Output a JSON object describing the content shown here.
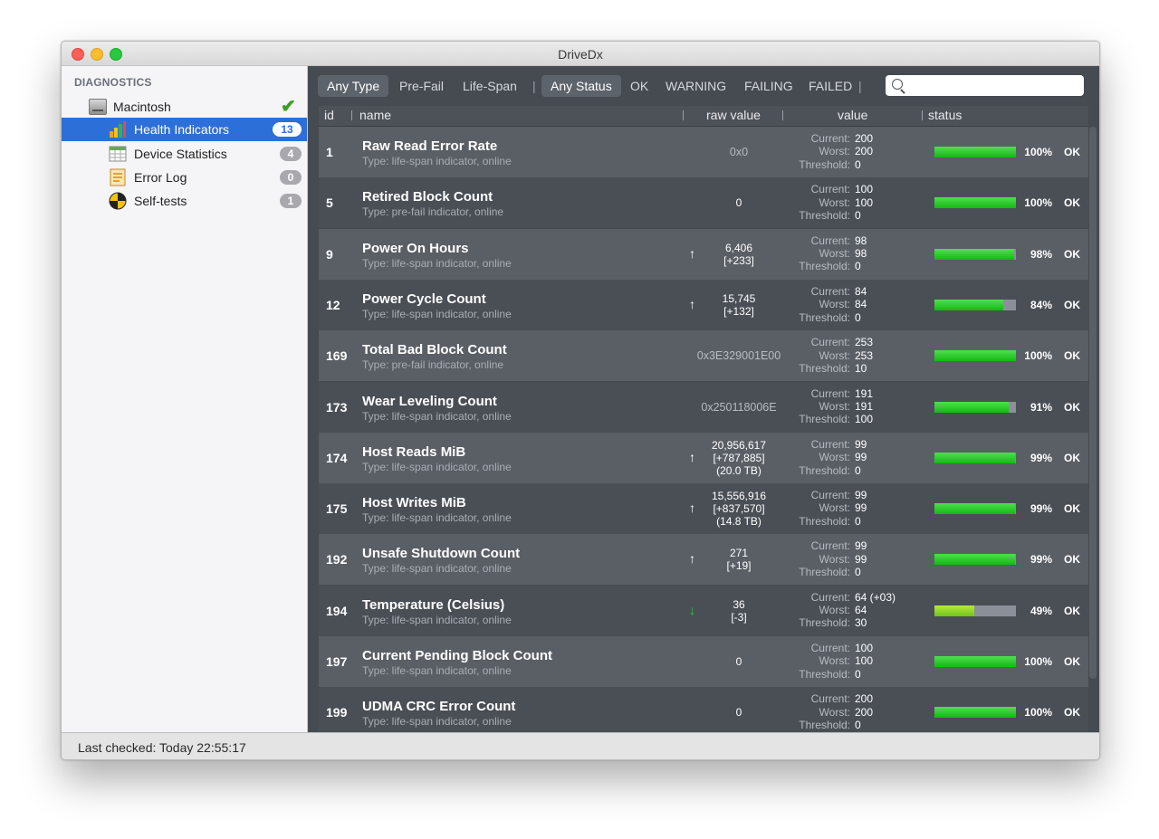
{
  "window": {
    "title": "DriveDx"
  },
  "sidebar": {
    "header": "DIAGNOSTICS",
    "drive": {
      "label": "Macintosh",
      "status_icon": "checkmark-icon"
    },
    "items": [
      {
        "label": "Health Indicators",
        "badge": "13",
        "icon": "bar-chart-icon",
        "selected": true
      },
      {
        "label": "Device Statistics",
        "badge": "4",
        "icon": "table-icon",
        "selected": false
      },
      {
        "label": "Error Log",
        "badge": "0",
        "icon": "log-icon",
        "selected": false
      },
      {
        "label": "Self-tests",
        "badge": "1",
        "icon": "test-target-icon",
        "selected": false
      }
    ]
  },
  "filters": {
    "type": [
      "Any Type",
      "Pre-Fail",
      "Life-Span"
    ],
    "status": [
      "Any Status",
      "OK",
      "WARNING",
      "FAILING",
      "FAILED"
    ],
    "active_type": "Any Type",
    "active_status": "Any Status",
    "search": {
      "value": "",
      "placeholder": ""
    }
  },
  "columns": {
    "id": "id",
    "name": "name",
    "raw": "raw value",
    "value": "value",
    "status": "status"
  },
  "value_labels": {
    "current": "Current:",
    "worst": "Worst:",
    "threshold": "Threshold:"
  },
  "rows": [
    {
      "id": "1",
      "name": "Raw Read Error Rate",
      "type": "Type: life-span indicator, online",
      "raw": [
        "0x0"
      ],
      "raw_dim": true,
      "trend": "",
      "current": "200",
      "worst": "200",
      "threshold": "0",
      "pct": "100%",
      "fill": 1.0,
      "status": "OK"
    },
    {
      "id": "5",
      "name": "Retired Block Count",
      "type": "Type: pre-fail indicator, online",
      "raw": [
        "0"
      ],
      "raw_dim": false,
      "trend": "",
      "current": "100",
      "worst": "100",
      "threshold": "0",
      "pct": "100%",
      "fill": 1.0,
      "status": "OK"
    },
    {
      "id": "9",
      "name": "Power On Hours",
      "type": "Type: life-span indicator, online",
      "raw": [
        "6,406",
        "[+233]"
      ],
      "raw_dim": false,
      "trend": "up",
      "current": "98",
      "worst": "98",
      "threshold": "0",
      "pct": "98%",
      "fill": 0.98,
      "status": "OK"
    },
    {
      "id": "12",
      "name": "Power Cycle Count",
      "type": "Type: life-span indicator, online",
      "raw": [
        "15,745",
        "[+132]"
      ],
      "raw_dim": false,
      "trend": "up",
      "current": "84",
      "worst": "84",
      "threshold": "0",
      "pct": "84%",
      "fill": 0.84,
      "status": "OK"
    },
    {
      "id": "169",
      "name": "Total Bad Block Count",
      "type": "Type: pre-fail indicator, online",
      "raw": [
        "0x3E329001E00"
      ],
      "raw_dim": true,
      "trend": "",
      "current": "253",
      "worst": "253",
      "threshold": "10",
      "pct": "100%",
      "fill": 1.0,
      "status": "OK"
    },
    {
      "id": "173",
      "name": "Wear Leveling Count",
      "type": "Type: life-span indicator, online",
      "raw": [
        "0x250118006E"
      ],
      "raw_dim": true,
      "trend": "",
      "current": "191",
      "worst": "191",
      "threshold": "100",
      "pct": "91%",
      "fill": 0.91,
      "status": "OK"
    },
    {
      "id": "174",
      "name": "Host Reads MiB",
      "type": "Type: life-span indicator, online",
      "raw": [
        "20,956,617",
        "[+787,885]",
        "(20.0 TB)"
      ],
      "raw_dim": false,
      "trend": "up",
      "current": "99",
      "worst": "99",
      "threshold": "0",
      "pct": "99%",
      "fill": 0.99,
      "status": "OK"
    },
    {
      "id": "175",
      "name": "Host Writes MiB",
      "type": "Type: life-span indicator, online",
      "raw": [
        "15,556,916",
        "[+837,570]",
        "(14.8 TB)"
      ],
      "raw_dim": false,
      "trend": "up",
      "current": "99",
      "worst": "99",
      "threshold": "0",
      "pct": "99%",
      "fill": 0.99,
      "status": "OK"
    },
    {
      "id": "192",
      "name": "Unsafe Shutdown Count",
      "type": "Type: life-span indicator, online",
      "raw": [
        "271",
        "[+19]"
      ],
      "raw_dim": false,
      "trend": "up",
      "current": "99",
      "worst": "99",
      "threshold": "0",
      "pct": "99%",
      "fill": 0.99,
      "status": "OK"
    },
    {
      "id": "194",
      "name": "Temperature (Celsius)",
      "type": "Type: life-span indicator, online",
      "raw": [
        "36",
        "[-3]"
      ],
      "raw_dim": false,
      "trend": "down",
      "current": "64  (+03)",
      "worst": "64",
      "threshold": "30",
      "pct": "49%",
      "fill": 0.49,
      "status": "OK",
      "lime": true
    },
    {
      "id": "197",
      "name": "Current Pending Block Count",
      "type": "Type: life-span indicator, online",
      "raw": [
        "0"
      ],
      "raw_dim": false,
      "trend": "",
      "current": "100",
      "worst": "100",
      "threshold": "0",
      "pct": "100%",
      "fill": 1.0,
      "status": "OK"
    },
    {
      "id": "199",
      "name": "UDMA CRC Error Count",
      "type": "Type: life-span indicator, online",
      "raw": [
        "0"
      ],
      "raw_dim": false,
      "trend": "",
      "current": "200",
      "worst": "200",
      "threshold": "0",
      "pct": "100%",
      "fill": 1.0,
      "status": "OK"
    }
  ],
  "statusbar": {
    "text": "Last checked: Today 22:55:17"
  },
  "colors": {
    "selected": "#2d6fd8",
    "bar_fill": "#1fc41f",
    "bar_warn": "#8fd42a",
    "panel": "#464b52"
  }
}
